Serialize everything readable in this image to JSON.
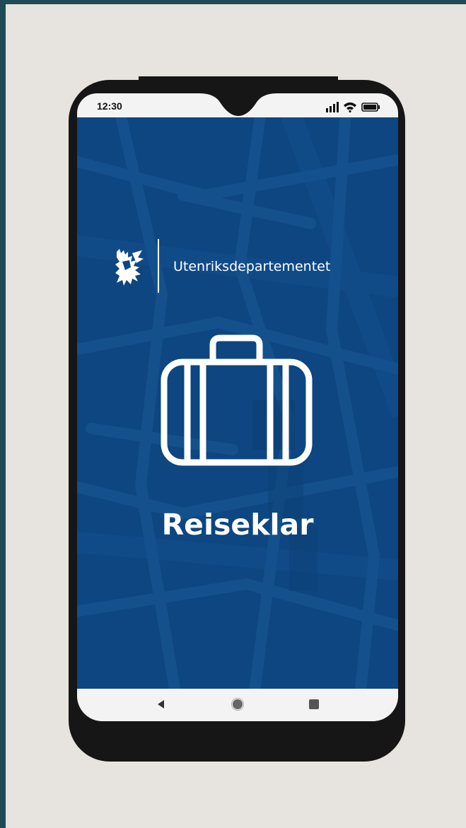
{
  "status_bar": {
    "time": "12:30"
  },
  "header": {
    "ministry_name": "Utenriksdepartementet"
  },
  "main": {
    "app_title": "Reiseklar"
  },
  "icons": {
    "logo": "coat-of-arms-icon",
    "hero": "suitcase-icon",
    "signal": "signal-icon",
    "wifi": "wifi-icon",
    "battery": "battery-icon",
    "nav_back": "back-icon",
    "nav_home": "home-icon",
    "nav_recents": "recents-icon"
  },
  "colors": {
    "app_background": "#0d4680",
    "page_background": "#e7e3de",
    "frame": "#161616",
    "foreground": "#ffffff"
  }
}
